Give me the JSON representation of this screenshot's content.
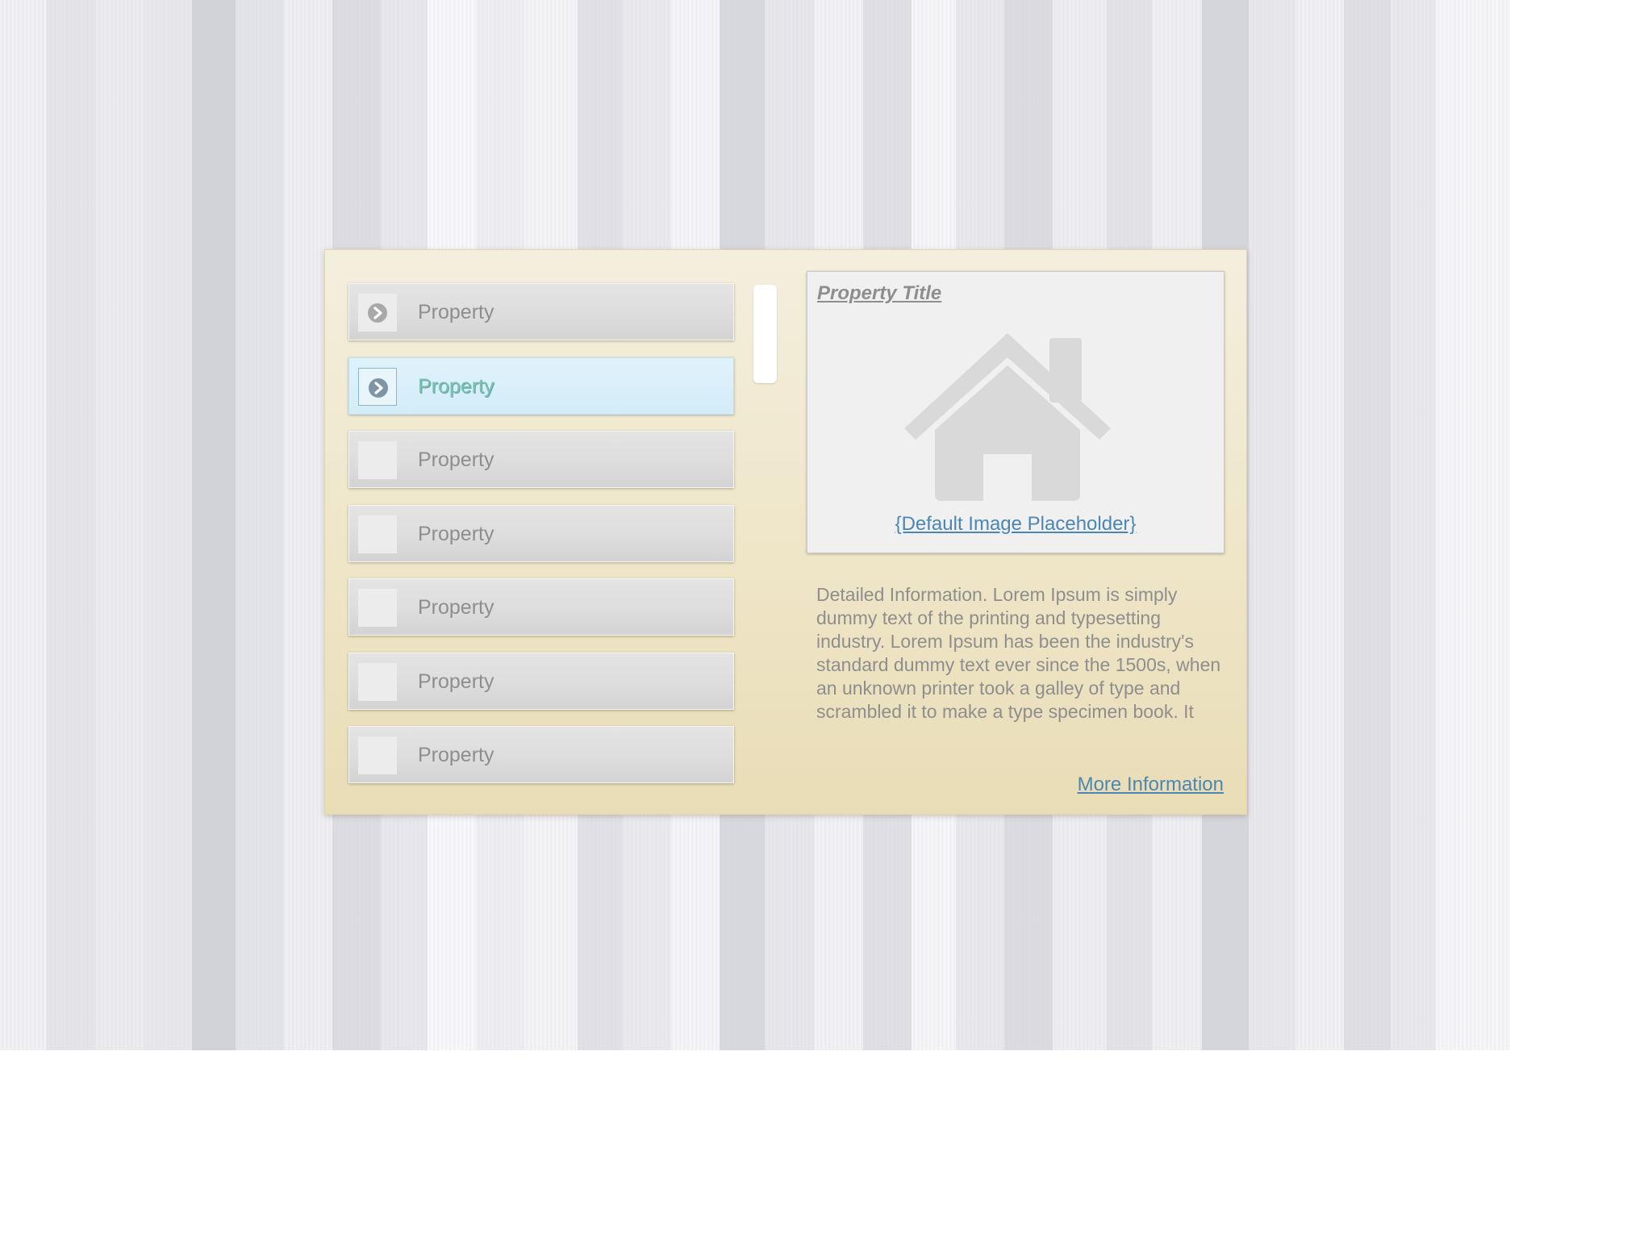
{
  "list": {
    "items": [
      {
        "label": "Property",
        "has_arrow": true,
        "selected": false
      },
      {
        "label": "Property",
        "has_arrow": true,
        "selected": true
      },
      {
        "label": "Property",
        "has_arrow": false,
        "selected": false
      },
      {
        "label": "Property",
        "has_arrow": false,
        "selected": false
      },
      {
        "label": "Property",
        "has_arrow": false,
        "selected": false
      },
      {
        "label": "Property",
        "has_arrow": false,
        "selected": false
      },
      {
        "label": "Property",
        "has_arrow": false,
        "selected": false
      }
    ]
  },
  "preview": {
    "title": "Property Title",
    "image_icon": "house-icon",
    "placeholder_link": "{Default Image Placeholder}"
  },
  "details": {
    "text": "Detailed Information. Lorem Ipsum is simply dummy text of the printing and typesetting industry. Lorem Ipsum has been the industry's standard dummy text ever since the 1500s, when an unknown printer took a galley of type and scrambled it to make a type specimen book. It has survived not only five centuries,",
    "more_link": "More Information"
  },
  "colors": {
    "panel": "#efe6c8",
    "link": "#4c86b2",
    "selected_row": "#d3edf8",
    "selected_text": "#79c3ae"
  }
}
